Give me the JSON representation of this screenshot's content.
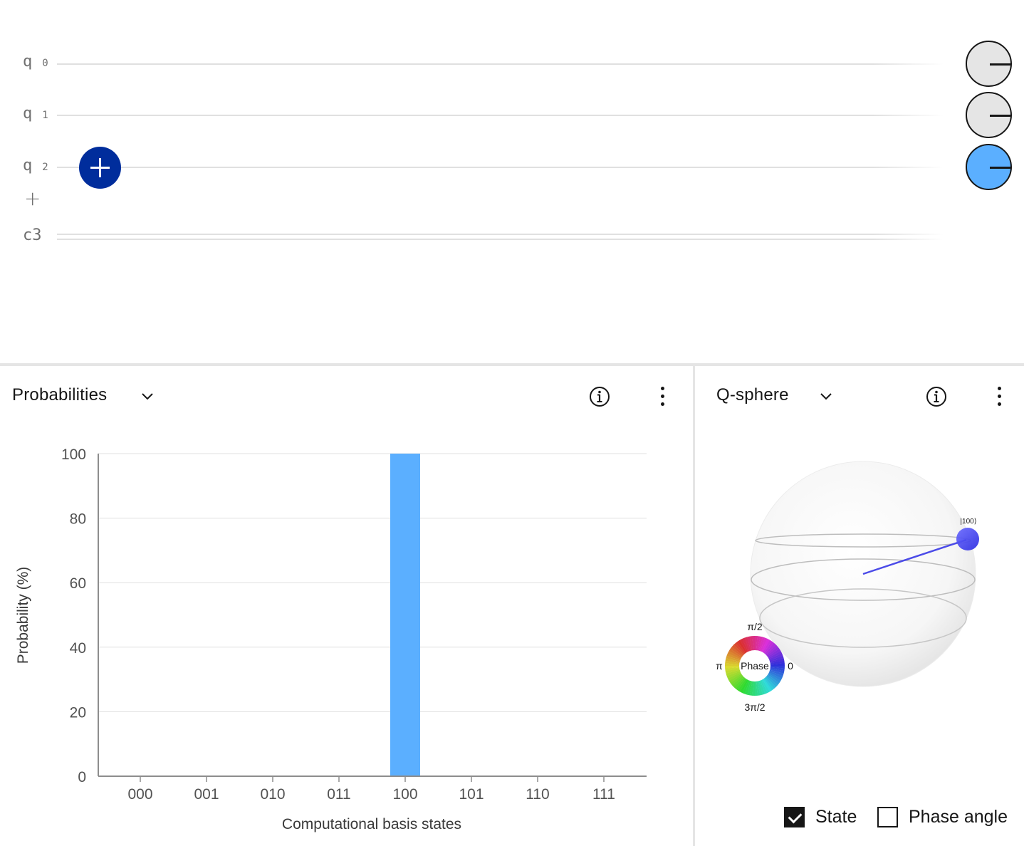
{
  "circuit": {
    "qubits": [
      {
        "name": "q",
        "index": "0",
        "measure_state": "0"
      },
      {
        "name": "q",
        "index": "1",
        "measure_state": "0"
      },
      {
        "name": "q",
        "index": "2",
        "measure_state": "1"
      }
    ],
    "add_qubit_symbol": "+",
    "classical_register": "c3",
    "gates": [
      {
        "type": "X",
        "icon": "plus-icon",
        "qubit": 2,
        "color": "#002d9c"
      }
    ],
    "measure_colors": {
      "zero": "#e5e5e5",
      "one": "#5bafff"
    }
  },
  "probabilities_panel": {
    "title": "Probabilities",
    "menu_icon": "overflow-menu-icon",
    "info_icon": "information-icon"
  },
  "qsphere_panel": {
    "title": "Q-sphere",
    "state_label": "|100⟩",
    "phase_wheel": {
      "center": "Phase",
      "top": "π/2",
      "left": "π",
      "right": "0",
      "bottom": "3π/2"
    },
    "options": [
      {
        "label": "State",
        "checked": true
      },
      {
        "label": "Phase angle",
        "checked": false
      }
    ],
    "state_color": "#3b3bf0"
  },
  "chart_data": {
    "type": "bar",
    "categories": [
      "000",
      "001",
      "010",
      "011",
      "100",
      "101",
      "110",
      "111"
    ],
    "values": [
      0,
      0,
      0,
      0,
      100,
      0,
      0,
      0
    ],
    "xlabel": "Computational basis states",
    "ylabel": "Probability (%)",
    "ylim": [
      0,
      100
    ],
    "yticks": [
      0,
      20,
      40,
      60,
      80,
      100
    ],
    "grid": true,
    "bar_color": "#5bafff"
  }
}
